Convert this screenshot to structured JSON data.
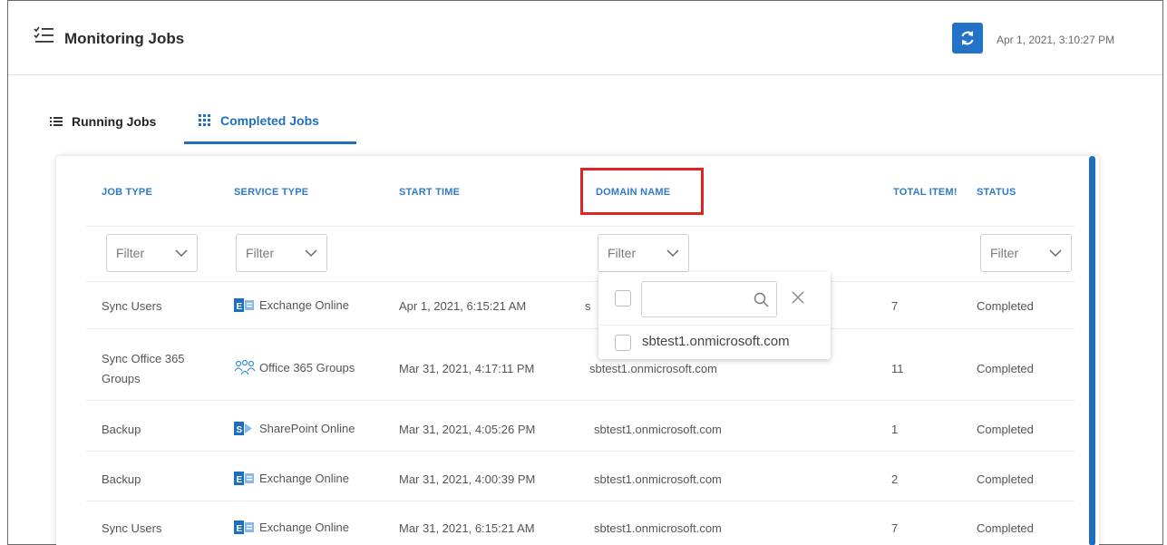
{
  "header": {
    "title": "Monitoring Jobs",
    "timestamp": "Apr 1, 2021, 3:10:27 PM"
  },
  "tabs": [
    {
      "label": "Running Jobs",
      "active": false
    },
    {
      "label": "Completed Jobs",
      "active": true
    }
  ],
  "table": {
    "columns": [
      "JOB TYPE",
      "SERVICE TYPE",
      "START TIME",
      "DOMAIN NAME",
      "TOTAL ITEMS",
      "STATUS"
    ],
    "column_visible_text": [
      "JOB TYPE",
      "SERVICE TYPE",
      "START TIME",
      "DOMAIN NAME",
      "TOTAL ITEM!",
      "STATUS"
    ],
    "filter_placeholder": "Filter",
    "rows": [
      {
        "job_type": "Sync Users",
        "service": "Exchange Online",
        "service_icon": "exchange-online-icon",
        "start_time": "Apr 1, 2021, 6:15:21 AM",
        "domain": "s",
        "total": "7",
        "status": "Completed"
      },
      {
        "job_type": "Sync Office 365 Groups",
        "job_type_line1": "Sync Office 365",
        "job_type_line2": "Groups",
        "service": "Office 365 Groups",
        "service_icon": "office365-groups-icon",
        "start_time": "Mar 31, 2021, 4:17:11 PM",
        "domain": "sbtest1.onmicrosoft.com",
        "total": "11",
        "status": "Completed"
      },
      {
        "job_type": "Backup",
        "service": "SharePoint Online",
        "service_icon": "sharepoint-online-icon",
        "start_time": "Mar 31, 2021, 4:05:26 PM",
        "domain": "sbtest1.onmicrosoft.com",
        "total": "1",
        "status": "Completed"
      },
      {
        "job_type": "Backup",
        "service": "Exchange Online",
        "service_icon": "exchange-online-icon",
        "start_time": "Mar 31, 2021, 4:00:39 PM",
        "domain": "sbtest1.onmicrosoft.com",
        "total": "2",
        "status": "Completed"
      },
      {
        "job_type": "Sync Users",
        "service": "Exchange Online",
        "service_icon": "exchange-online-icon",
        "start_time": "Mar 31, 2021, 6:15:21 AM",
        "domain": "sbtest1.onmicrosoft.com",
        "total": "7",
        "status": "Completed"
      }
    ]
  },
  "domain_filter_dropdown": {
    "search_value": "",
    "options": [
      {
        "label": "sbtest1.onmicrosoft.com",
        "checked": false
      }
    ]
  },
  "colors": {
    "accent": "#1f6fbf",
    "highlight": "#e02424",
    "refresh_button": "#2272c8"
  }
}
